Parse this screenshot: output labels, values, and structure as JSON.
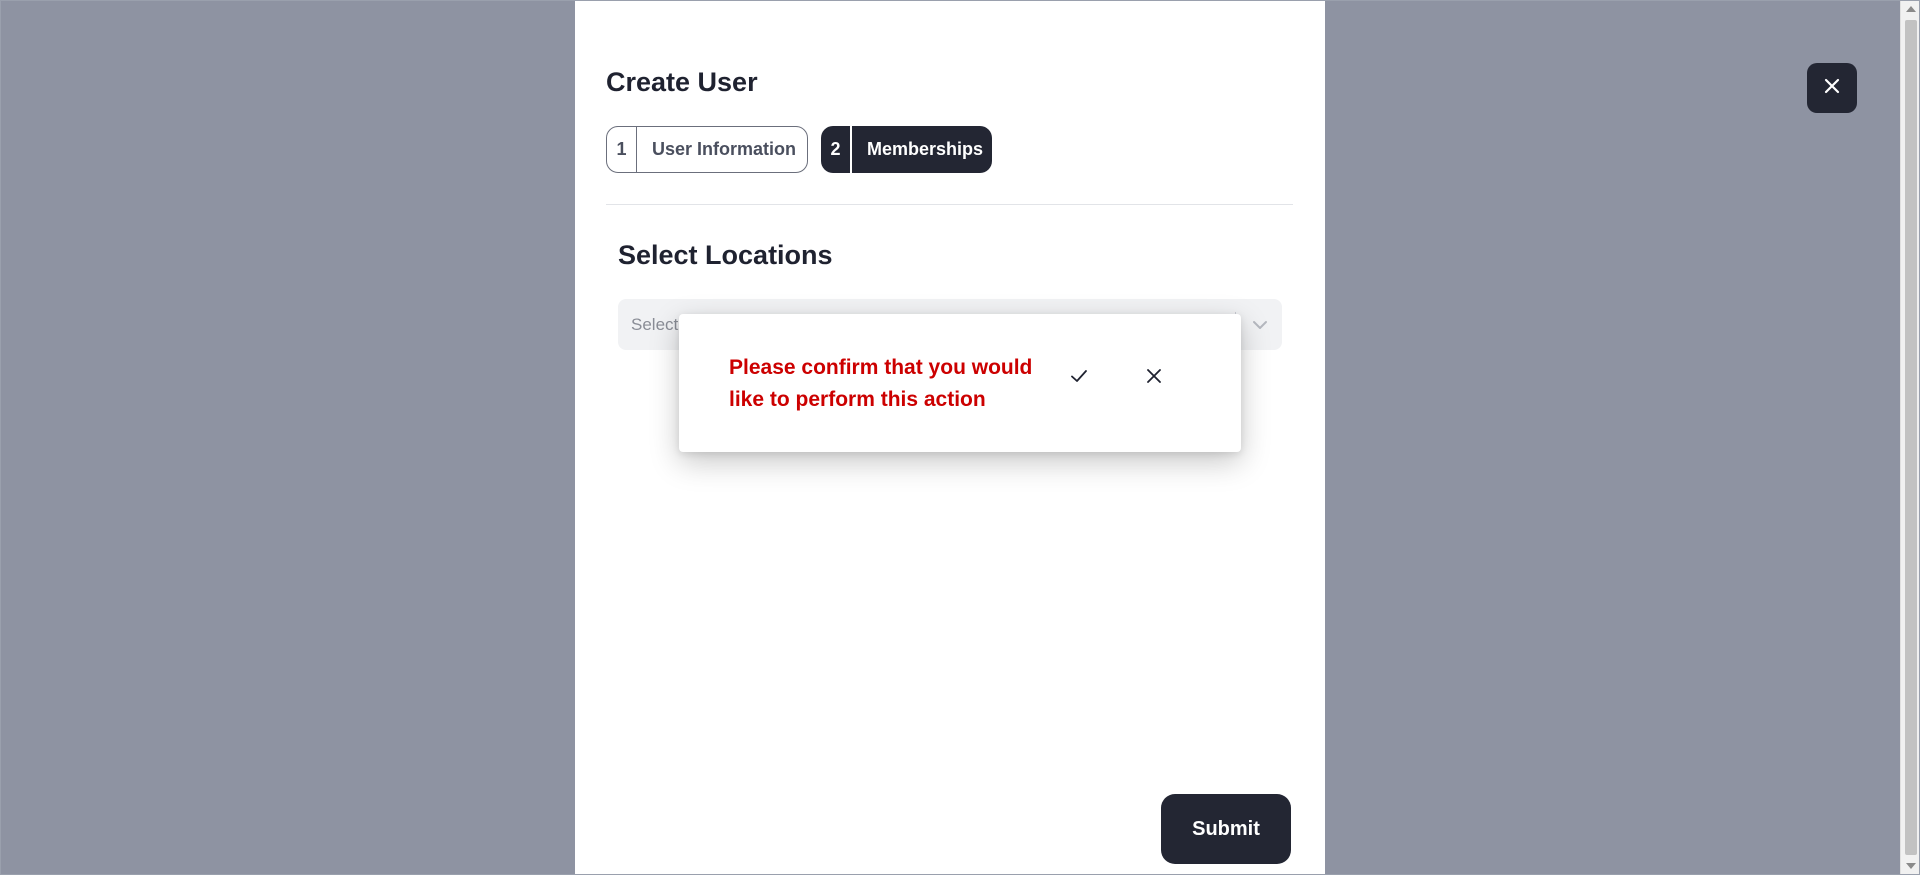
{
  "modal": {
    "title": "Create User",
    "steps": [
      {
        "number": "1",
        "label": "User Information",
        "active": false
      },
      {
        "number": "2",
        "label": "Memberships",
        "active": true
      }
    ],
    "section_title": "Select Locations",
    "locations_select": {
      "placeholder": "Select..."
    },
    "submit_label": "Submit"
  },
  "confirm": {
    "message": "Please confirm that you would like to perform this action",
    "confirm_icon": "check-icon",
    "cancel_icon": "close-icon",
    "message_color": "#cc0000"
  },
  "overlay": {
    "close_icon": "close-icon",
    "backdrop_color": "#8e93a2",
    "accent_color": "#232633"
  }
}
